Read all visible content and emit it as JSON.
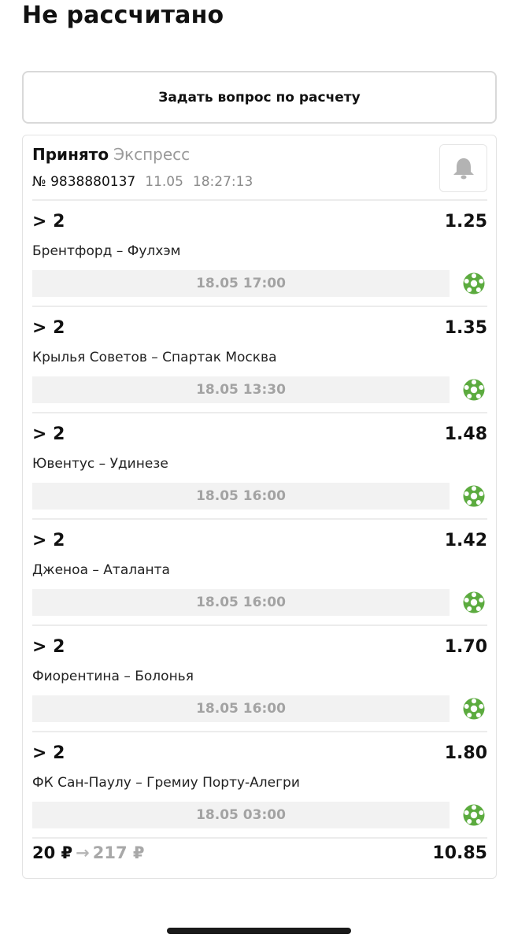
{
  "page_title": "Не рассчитано",
  "ask_button_label": "Задать вопрос по расчету",
  "bet": {
    "status": "Принято",
    "type": "Экспресс",
    "number": "№ 9838880137",
    "date": "11.05",
    "time": "18:27:13"
  },
  "events": [
    {
      "outcome": "> 2",
      "odds": "1.25",
      "teams": "Брентфорд – Фулхэм",
      "datetime": "18.05 17:00",
      "sport_icon": "soccer-ball-icon"
    },
    {
      "outcome": "> 2",
      "odds": "1.35",
      "teams": "Крылья Советов – Спартак Москва",
      "datetime": "18.05 13:30",
      "sport_icon": "soccer-ball-icon"
    },
    {
      "outcome": "> 2",
      "odds": "1.48",
      "teams": "Ювентус – Удинезе",
      "datetime": "18.05 16:00",
      "sport_icon": "soccer-ball-icon"
    },
    {
      "outcome": "> 2",
      "odds": "1.42",
      "teams": "Дженоа – Аталанта",
      "datetime": "18.05 16:00",
      "sport_icon": "soccer-ball-icon"
    },
    {
      "outcome": "> 2",
      "odds": "1.70",
      "teams": "Фиорентина – Болонья",
      "datetime": "18.05 16:00",
      "sport_icon": "soccer-ball-icon"
    },
    {
      "outcome": "> 2",
      "odds": "1.80",
      "teams": "ФК Сан-Паулу – Гремиу Порту-Алегри",
      "datetime": "18.05 03:00",
      "sport_icon": "soccer-ball-icon"
    }
  ],
  "footer": {
    "stake": "20 ₽",
    "arrow": "→",
    "payout": "217 ₽",
    "total_odds": "10.85"
  },
  "icons": {
    "bell": "bell-icon",
    "sport": "soccer-ball-icon"
  },
  "colors": {
    "accent_green": "#5cab3f",
    "muted_gray": "#a3a3a3",
    "bell_gray": "#b3b3b3"
  }
}
